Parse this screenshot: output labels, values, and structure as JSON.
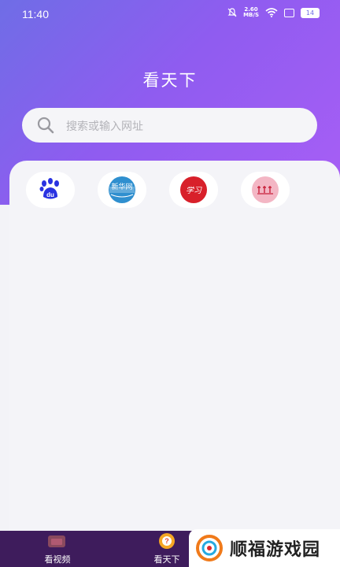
{
  "status_bar": {
    "time": "11:40",
    "net_speed_value": "2.60",
    "net_speed_unit": "MB/S",
    "battery": "14"
  },
  "header": {
    "title": "看天下"
  },
  "search": {
    "placeholder": "搜索或输入网址"
  },
  "shortcuts": [
    {
      "name": "baidu",
      "icon_text": "du"
    },
    {
      "name": "xinhua",
      "icon_text": "新华网"
    },
    {
      "name": "xuexi",
      "icon_text": "学习"
    },
    {
      "name": "site4",
      "icon_text": ""
    }
  ],
  "bottom_nav": {
    "items": [
      {
        "label": "看视频",
        "icon": "video-icon"
      },
      {
        "label": "看天下",
        "icon": "globe-icon",
        "active": true
      }
    ]
  },
  "watermark": {
    "text": "顺福游戏园"
  },
  "colors": {
    "accent_start": "#6f6de6",
    "accent_end": "#a85ef5",
    "nav_bg": "#3e1c5c"
  }
}
